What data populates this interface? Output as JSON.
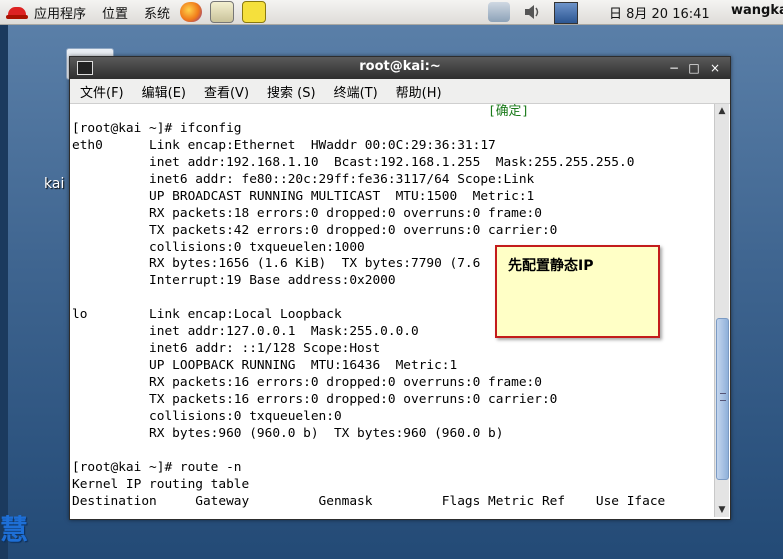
{
  "top_panel": {
    "menus": [
      "应用程序",
      "位置",
      "系统"
    ],
    "clock": "日  8月 20 16:41",
    "user": "wangka"
  },
  "desktop": {
    "icon_label": "kai",
    "watermark_text": "慧"
  },
  "window": {
    "title": "root@kai:~",
    "buttons": [
      "−",
      "□",
      "×"
    ],
    "menu": [
      "文件(F)",
      "编辑(E)",
      "查看(V)",
      "搜索 (S)",
      "终端(T)",
      "帮助(H)"
    ]
  },
  "terminal": {
    "lines": [
      "                                                      [确定]",
      "[root@kai ~]# ifconfig",
      "eth0      Link encap:Ethernet  HWaddr 00:0C:29:36:31:17",
      "          inet addr:192.168.1.10  Bcast:192.168.1.255  Mask:255.255.255.0",
      "          inet6 addr: fe80::20c:29ff:fe36:3117/64 Scope:Link",
      "          UP BROADCAST RUNNING MULTICAST  MTU:1500  Metric:1",
      "          RX packets:18 errors:0 dropped:0 overruns:0 frame:0",
      "          TX packets:42 errors:0 dropped:0 overruns:0 carrier:0",
      "          collisions:0 txqueuelen:1000",
      "          RX bytes:1656 (1.6 KiB)  TX bytes:7790 (7.6",
      "          Interrupt:19 Base address:0x2000",
      "",
      "lo        Link encap:Local Loopback",
      "          inet addr:127.0.0.1  Mask:255.0.0.0",
      "          inet6 addr: ::1/128 Scope:Host",
      "          UP LOOPBACK RUNNING  MTU:16436  Metric:1",
      "          RX packets:16 errors:0 dropped:0 overruns:0 frame:0",
      "          TX packets:16 errors:0 dropped:0 overruns:0 carrier:0",
      "          collisions:0 txqueuelen:0",
      "          RX bytes:960 (960.0 b)  TX bytes:960 (960.0 b)",
      "",
      "[root@kai ~]# route -n",
      "Kernel IP routing table",
      "Destination     Gateway         Genmask         Flags Metric Ref    Use Iface"
    ]
  },
  "annotation": {
    "text": "先配置静态IP"
  }
}
